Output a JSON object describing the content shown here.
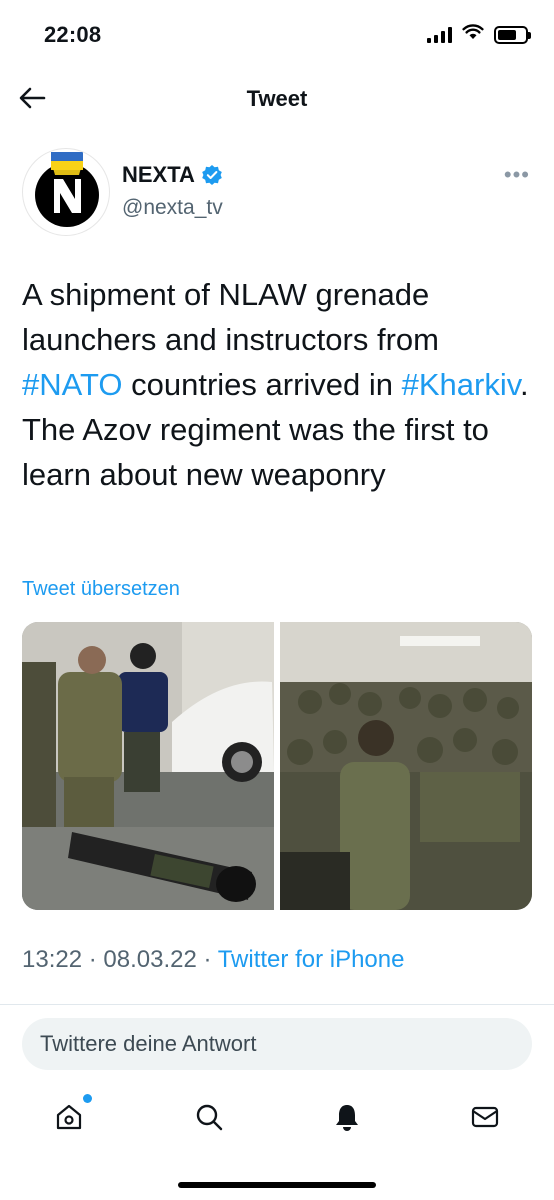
{
  "status": {
    "time": "22:08",
    "battery_level": 0.7
  },
  "nav": {
    "title": "Tweet"
  },
  "author": {
    "name": "NEXTA",
    "handle": "@nexta_tv",
    "verified": true,
    "avatar_letter": "N"
  },
  "tweet": {
    "segments": [
      {
        "type": "text",
        "value": "A shipment of NLAW grenade launchers and instructors from "
      },
      {
        "type": "hashtag",
        "value": "#NATO"
      },
      {
        "type": "text",
        "value": " countries arrived in "
      },
      {
        "type": "hashtag",
        "value": "#Kharkiv"
      },
      {
        "type": "text",
        "value": ". The Azov regiment was the first to learn about new weaponry"
      }
    ],
    "translate_label": "Tweet übersetzen",
    "media_count": 2
  },
  "meta": {
    "time": "13:22",
    "date": "08.03.22",
    "separator": " · ",
    "source": "Twitter for iPhone"
  },
  "reply": {
    "placeholder": "Twittere deine Antwort"
  },
  "tabs": [
    {
      "icon": "home-icon",
      "has_notification_dot": true
    },
    {
      "icon": "search-icon",
      "has_notification_dot": false
    },
    {
      "icon": "bell-icon",
      "has_notification_dot": false
    },
    {
      "icon": "mail-icon",
      "has_notification_dot": false
    }
  ],
  "colors": {
    "accent": "#1d9bf0",
    "text": "#0f1419",
    "secondary": "#536471",
    "ukraine_blue": "#2f6cc4",
    "ukraine_yellow": "#f7d117"
  }
}
